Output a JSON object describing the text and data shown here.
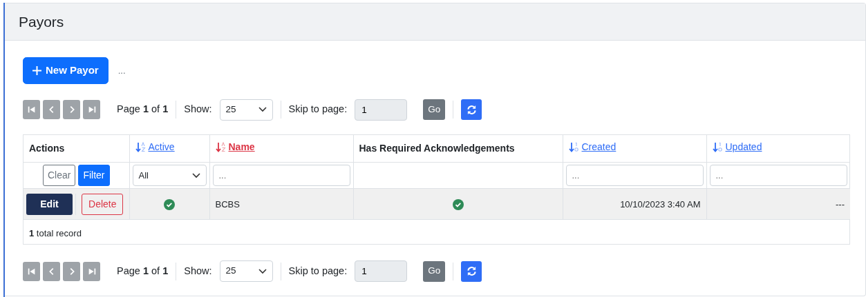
{
  "title": "Payors",
  "new_button": {
    "label": "New Payor"
  },
  "toolbar_note": "...",
  "pagers": [
    {
      "disabled": true,
      "page_text": "Page **1** of **1**",
      "show_label": "Show:",
      "page_size": "25",
      "skip_label": "Skip to page:",
      "skip_value": "1",
      "go": "Go"
    },
    {
      "disabled": true,
      "page_text": "Page **1** of **1**",
      "show_label": "Show:",
      "page_size": "25",
      "skip_label": "Skip to page:",
      "skip_value": "1",
      "go": "Go"
    }
  ],
  "table": {
    "columns": [
      {
        "label": "Actions",
        "kind": "plain"
      },
      {
        "label": "Active",
        "kind": "alpha",
        "selected": false
      },
      {
        "label": "Name",
        "kind": "alpha",
        "selected": true
      },
      {
        "label": "Has Required Acknowledgements",
        "kind": "plain"
      },
      {
        "label": "Created",
        "kind": "numeric",
        "selected": false
      },
      {
        "label": "Updated",
        "kind": "numeric",
        "selected": false
      }
    ],
    "filters": [
      {
        "kind": "actions",
        "clear": "Clear",
        "filter": "Filter"
      },
      {
        "kind": "select",
        "value": "All"
      },
      {
        "kind": "text",
        "placeholder": "..."
      },
      {
        "kind": "none"
      },
      {
        "kind": "text",
        "placeholder": "..."
      },
      {
        "kind": "text",
        "placeholder": "..."
      }
    ],
    "rows": [
      {
        "edit": "Edit",
        "delete": "Delete",
        "active": true,
        "name": "BCBS",
        "has_ack": true,
        "created": "10/10/2023 3:40 AM",
        "updated": "---"
      }
    ],
    "footer": "**1** total record"
  }
}
